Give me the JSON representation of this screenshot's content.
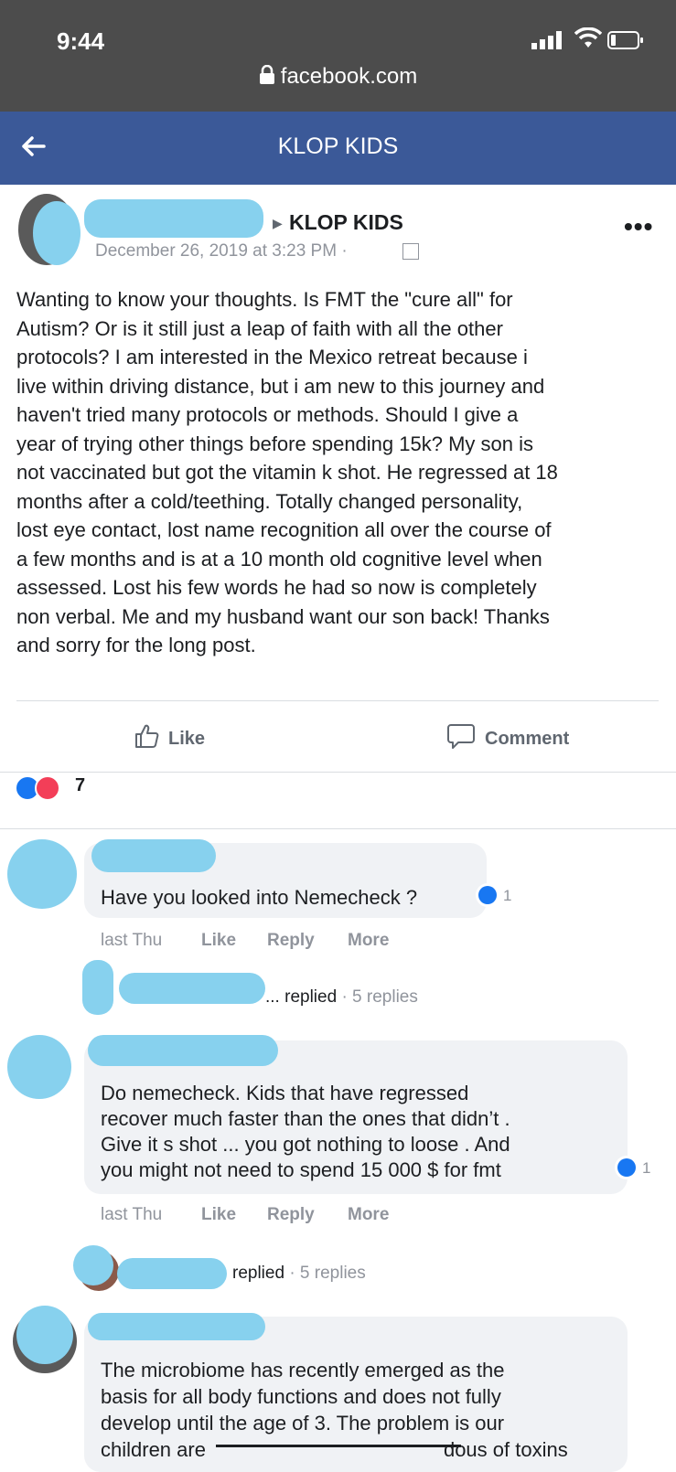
{
  "status_bar": {
    "time": "9:44",
    "url": "facebook.com"
  },
  "nav": {
    "title": "KLOP KIDS"
  },
  "post": {
    "group": "KLOP KIDS",
    "date": "December 26, 2019 at 3:23 PM ·",
    "lines": [
      "Wanting to know your thoughts. Is FMT the \"cure all\" for",
      "Autism? Or is it still just a leap of faith with all the other",
      "protocols? I am interested in the Mexico retreat because i",
      "live within driving distance, but i am new to this journey and",
      "haven't tried many protocols or methods. Should I give a",
      "year of trying other things before spending 15k? My son is",
      "not vaccinated but got the vitamin k shot. He regressed at 18",
      "months after a cold/teething. Totally changed personality,",
      "lost eye contact, lost name recognition all over the course of",
      "a few months and is at a 10 month old cognitive level when",
      "assessed. Lost his few words he had so now is completely",
      "non verbal. Me and my husband want our son back! Thanks",
      "and sorry for the long post."
    ],
    "actions": {
      "like": "Like",
      "comment": "Comment"
    },
    "reaction_count": "7"
  },
  "comments": [
    {
      "lines": [
        "Have you looked into Nemecheck ?"
      ],
      "likes": "1",
      "time": "last Thu",
      "like": "Like",
      "reply": "Reply",
      "more": "More",
      "replies": {
        "name_tail": "...",
        "replied": "replied",
        "count": "· 5 replies"
      }
    },
    {
      "lines": [
        "Do nemecheck. Kids that have regressed",
        "recover much faster than the ones that didn’t .",
        "Give it s shot ... you got nothing to loose . And",
        "you might not need to spend 15 000 $ for fmt"
      ],
      "likes": "1",
      "time": "last Thu",
      "like": "Like",
      "reply": "Reply",
      "more": "More",
      "replies": {
        "replied": "replied",
        "count": "· 5 replies"
      }
    },
    {
      "lines": [
        "The microbiome has recently emerged as the",
        "basis for all body functions and does not fully",
        "develop until the age of 3. The problem is our"
      ],
      "last_line_start": "children are",
      "last_line_end": "dous of toxins"
    }
  ],
  "colors": {
    "nav": "#3b5998",
    "status": "#4c4c4c",
    "redaction": "#87d1ee",
    "like_blue": "#1877f2",
    "love_red": "#f33e58"
  }
}
